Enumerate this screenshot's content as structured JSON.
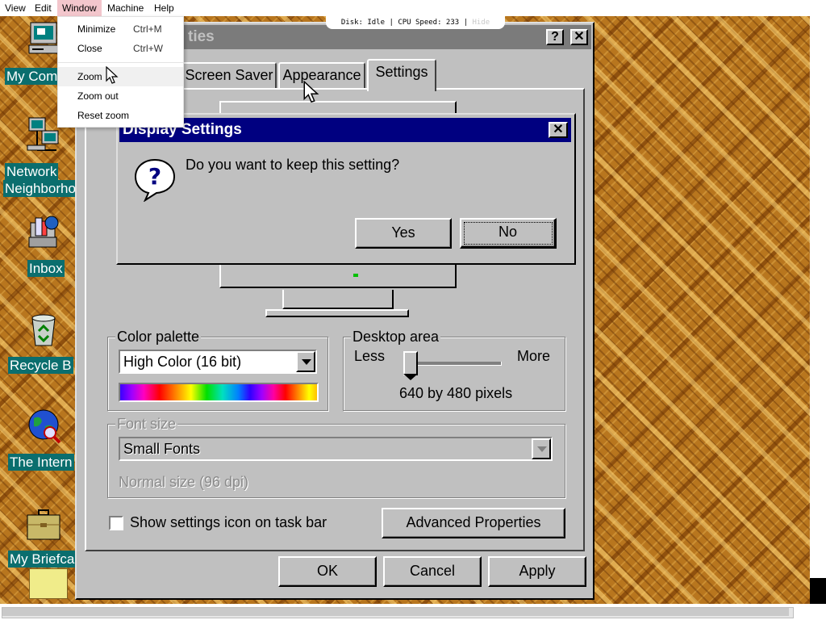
{
  "host": {
    "menus": [
      "View",
      "Edit",
      "Window",
      "Machine",
      "Help"
    ],
    "active_menu": "Window",
    "status": {
      "disk": "Disk: Idle",
      "cpu": "CPU Speed: 233",
      "hide": "Hide"
    },
    "window_menu": {
      "items": [
        {
          "label": "Minimize",
          "shortcut": "Ctrl+M"
        },
        {
          "label": "Close",
          "shortcut": "Ctrl+W"
        },
        {
          "label": "Zoom",
          "shortcut": ""
        },
        {
          "label": "Zoom out",
          "shortcut": ""
        },
        {
          "label": "Reset zoom",
          "shortcut": ""
        }
      ],
      "hovered": "Zoom"
    }
  },
  "desktop": {
    "icons": [
      {
        "label": "My Com",
        "icon": "my-computer-icon"
      },
      {
        "label": "Network",
        "label2": "Neighborho",
        "icon": "network-neighborhood-icon"
      },
      {
        "label": "Inbox",
        "icon": "inbox-icon"
      },
      {
        "label": "Recycle B",
        "icon": "recycle-bin-icon"
      },
      {
        "label": "The Intern",
        "icon": "internet-icon"
      },
      {
        "label": "My Briefca",
        "icon": "briefcase-icon"
      }
    ]
  },
  "properties": {
    "title": "ties",
    "help_btn": "?",
    "close_btn": "✕",
    "tabs": [
      "Screen Saver",
      "Appearance",
      "Settings"
    ],
    "selected_tab": "Settings",
    "color_palette": {
      "label": "Color palette",
      "value": "High Color (16 bit)"
    },
    "desktop_area": {
      "label": "Desktop area",
      "less": "Less",
      "more": "More",
      "value": "640 by 480 pixels",
      "slider_level": 0
    },
    "font_size": {
      "label": "Font size",
      "value": "Small Fonts",
      "note": "Normal size (96 dpi)"
    },
    "show_icon_label": "Show settings icon on task bar",
    "show_icon_checked": false,
    "advanced_label": "Advanced Properties",
    "ok_label": "OK",
    "cancel_label": "Cancel",
    "apply_label": "Apply"
  },
  "dialog": {
    "title": "Display Settings",
    "message": "Do you want to keep this setting?",
    "yes_label": "Yes",
    "no_label": "No",
    "close_btn": "✕"
  },
  "colors": {
    "title_active": "#000080",
    "title_inactive": "#7b7b7b",
    "face": "#c0c0c0",
    "desktop_label_bg": "#0b6e6e",
    "menu_active_bg": "#f3c6cc"
  }
}
